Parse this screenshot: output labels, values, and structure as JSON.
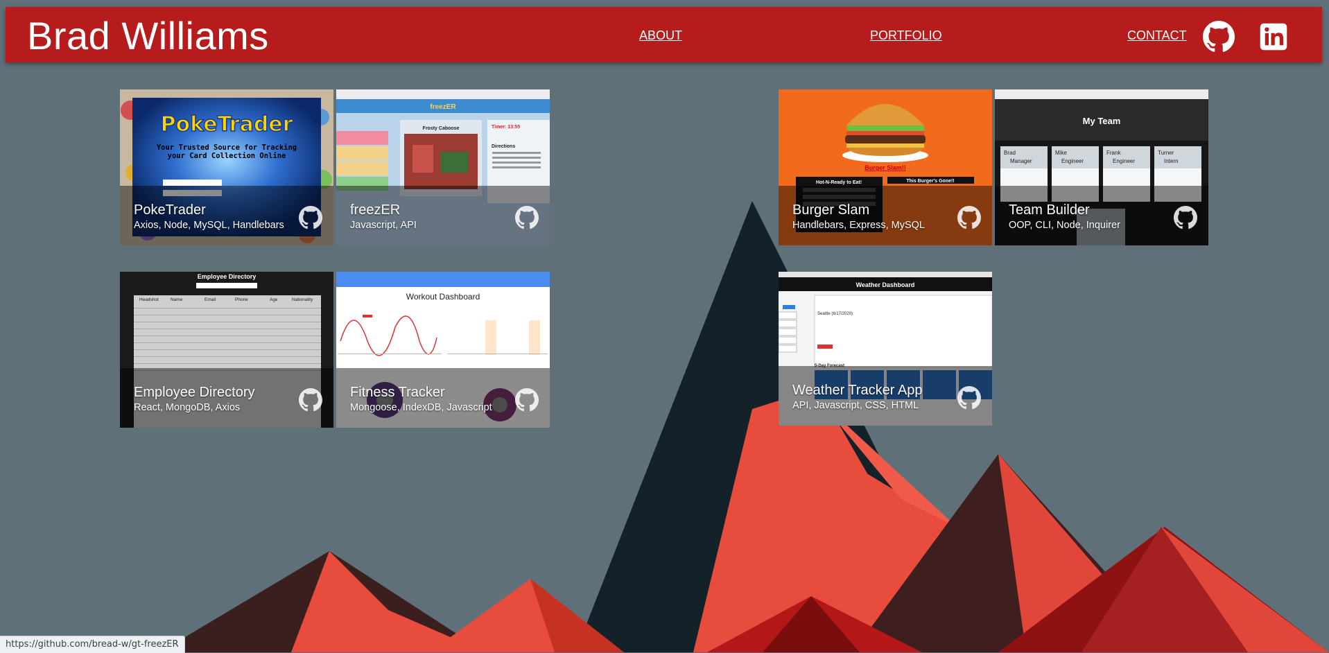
{
  "header": {
    "brand": "Brad Williams",
    "nav": {
      "about": "ABOUT",
      "portfolio": "PORTFOLIO",
      "contact": "CONTACT"
    },
    "icons": [
      "github-icon",
      "linkedin-icon"
    ],
    "bg_color": "#b71c1c"
  },
  "projects": [
    {
      "title": "PokeTrader",
      "tags": "Axios, Node, MySQL, Handlebars",
      "thumb_text": {
        "logo": "PokeTrader",
        "tagline": "Your Trusted Source for Tracking your Card Collection Online"
      }
    },
    {
      "title": "freezER",
      "tags": "Javascript, API",
      "thumb_text": {
        "brand": "freezER",
        "heading": "Frosty Caboose",
        "timer": "Timer: 13:55",
        "directions": "Directions"
      }
    },
    {
      "title": "Burger Slam",
      "tags": "Handlebars, Express, MySQL",
      "thumb_text": {
        "heading": "Burger Slam!!",
        "ready": "Hot-N-Ready to Eat!",
        "gone": "This Burger's Gone!!"
      }
    },
    {
      "title": "Team Builder",
      "tags": "OOP, CLI, Node, Inquirer",
      "thumb_text": {
        "heading": "My Team",
        "members": [
          {
            "name": "Brad",
            "role": "Manager"
          },
          {
            "name": "Mike",
            "role": "Engineer"
          },
          {
            "name": "Frank",
            "role": "Engineer"
          },
          {
            "name": "Turner",
            "role": "Intern"
          }
        ]
      }
    },
    {
      "title": "Employee Directory",
      "tags": "React, MongoDB, Axios",
      "thumb_text": {
        "heading": "Employee Directory",
        "columns": [
          "Headshot",
          "Name",
          "Email",
          "Phone",
          "Age",
          "Nationality"
        ]
      }
    },
    {
      "title": "Fitness Tracker",
      "tags": "Mongoose, IndexDB, Javascript",
      "thumb_text": {
        "heading": "Workout Dashboard"
      }
    },
    {
      "title": "Weather Tracker App",
      "tags": "API, Javascript, CSS, HTML",
      "thumb_text": {
        "heading": "Weather Dashboard",
        "city": "Seattle (6/17/2020)",
        "forecast": "5-Day Forecast"
      }
    }
  ],
  "status_url": "https://github.com/bread-w/gt-freezER",
  "colors": {
    "background": "#607079",
    "mountain_red": "#e84c3d",
    "mountain_dark": "#3b1f1f",
    "mountain_teal": "#132229"
  }
}
